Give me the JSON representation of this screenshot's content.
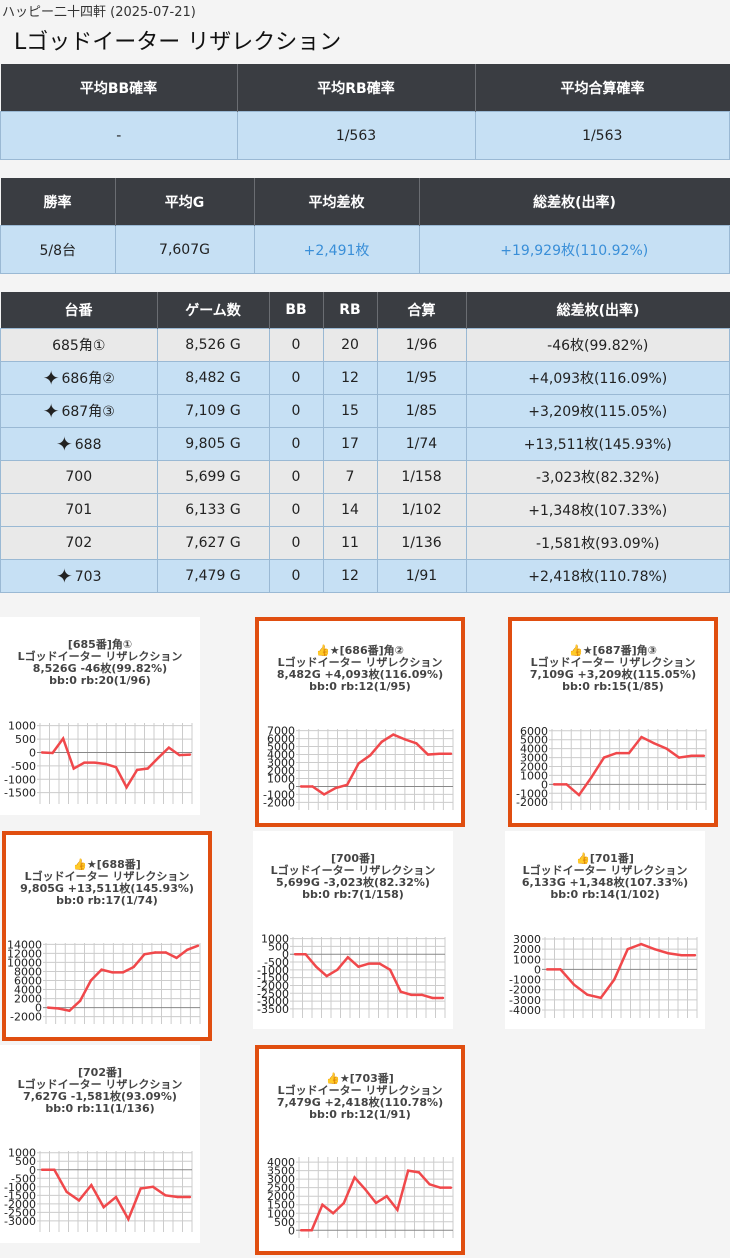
{
  "header": {
    "subtitle": "ハッピー二十四軒 (2025-07-21)",
    "title": "Lゴッドイーター リザレクション"
  },
  "summary1": {
    "headers": [
      "平均BB確率",
      "平均RB確率",
      "平均合算確率"
    ],
    "values": [
      "-",
      "1/563",
      "1/563"
    ]
  },
  "summary2": {
    "headers": [
      "勝率",
      "平均G",
      "平均差枚",
      "総差枚(出率)"
    ],
    "values": [
      "5/8台",
      "7,607G",
      "+2,491枚",
      "+19,929枚(110.92%)"
    ]
  },
  "machines": {
    "headers": [
      "台番",
      "ゲーム数",
      "BB",
      "RB",
      "合算",
      "総差枚(出率)"
    ],
    "rows": [
      {
        "no": "685角①",
        "games": "8,526 G",
        "bb": "0",
        "rb": "20",
        "total": "1/96",
        "diff": "-46枚(99.82%)",
        "star": false
      },
      {
        "no": "686角②",
        "games": "8,482 G",
        "bb": "0",
        "rb": "12",
        "total": "1/95",
        "diff": "+4,093枚(116.09%)",
        "star": true
      },
      {
        "no": "687角③",
        "games": "7,109 G",
        "bb": "0",
        "rb": "15",
        "total": "1/85",
        "diff": "+3,209枚(115.05%)",
        "star": true
      },
      {
        "no": "688",
        "games": "9,805 G",
        "bb": "0",
        "rb": "17",
        "total": "1/74",
        "diff": "+13,511枚(145.93%)",
        "star": true
      },
      {
        "no": "700",
        "games": "5,699 G",
        "bb": "0",
        "rb": "7",
        "total": "1/158",
        "diff": "-3,023枚(82.32%)",
        "star": false
      },
      {
        "no": "701",
        "games": "6,133 G",
        "bb": "0",
        "rb": "14",
        "total": "1/102",
        "diff": "+1,348枚(107.33%)",
        "star": false
      },
      {
        "no": "702",
        "games": "7,627 G",
        "bb": "0",
        "rb": "11",
        "total": "1/136",
        "diff": "-1,581枚(93.09%)",
        "star": false
      },
      {
        "no": "703",
        "games": "7,479 G",
        "bb": "0",
        "rb": "12",
        "total": "1/91",
        "diff": "+2,418枚(110.78%)",
        "star": true
      }
    ]
  },
  "chart_data": [
    {
      "type": "line",
      "title": [
        "[685番]角①",
        "Lゴッドイーター リザレクション",
        "8,526G -46枚(99.82%)",
        "bb:0 rb:20(1/96)"
      ],
      "yticks": [
        1000,
        500,
        0,
        -500,
        -1000,
        -1500
      ],
      "ylim": [
        -1700,
        1100
      ],
      "values": [
        0,
        -20,
        520,
        -600,
        -380,
        -380,
        -430,
        -550,
        -1300,
        -650,
        -600,
        -200,
        180,
        -100,
        -80
      ]
    },
    {
      "type": "line",
      "title": [
        "👍★[686番]角②",
        "Lゴッドイーター リザレクション",
        "8,482G +4,093枚(116.09%)",
        "bb:0 rb:12(1/95)"
      ],
      "yticks": [
        7000,
        6000,
        5000,
        4000,
        3000,
        2000,
        1000,
        0,
        -1000,
        -2000
      ],
      "ylim": [
        -2200,
        7200
      ],
      "values": [
        0,
        0,
        -1000,
        -200,
        200,
        2900,
        3900,
        5600,
        6500,
        5900,
        5400,
        4000,
        4100,
        4100
      ]
    },
    {
      "type": "line",
      "title": [
        "👍★[687番]角③",
        "Lゴッドイーター リザレクション",
        "7,109G +3,209枚(115.05%)",
        "bb:0 rb:15(1/85)"
      ],
      "yticks": [
        6000,
        5000,
        4000,
        3000,
        2000,
        1000,
        0,
        -1000,
        -2000
      ],
      "ylim": [
        -2200,
        6200
      ],
      "values": [
        0,
        0,
        -1200,
        800,
        3000,
        3500,
        3500,
        5300,
        4600,
        4000,
        3000,
        3200,
        3200
      ]
    },
    {
      "type": "line",
      "title": [
        "👍★[688番]",
        "Lゴッドイーター リザレクション",
        "9,805G +13,511枚(145.93%)",
        "bb:0 rb:17(1/74)"
      ],
      "yticks": [
        14000,
        12000,
        10000,
        8000,
        6000,
        4000,
        2000,
        0,
        -2000
      ],
      "ylim": [
        -2300,
        14300
      ],
      "values": [
        0,
        -200,
        -700,
        1500,
        6000,
        8400,
        7800,
        7800,
        9000,
        11800,
        12200,
        12200,
        11000,
        12800,
        13700
      ]
    },
    {
      "type": "line",
      "title": [
        "[700番]",
        "Lゴッドイーター リザレクション",
        "5,699G -3,023枚(82.32%)",
        "bb:0 rb:7(1/158)"
      ],
      "yticks": [
        1000,
        500,
        0,
        -500,
        -1000,
        -1500,
        -2000,
        -2500,
        -3000,
        -3500
      ],
      "ylim": [
        -3700,
        1100
      ],
      "values": [
        0,
        0,
        -800,
        -1400,
        -1000,
        -200,
        -800,
        -600,
        -600,
        -1000,
        -2400,
        -2600,
        -2600,
        -2800,
        -2800
      ]
    },
    {
      "type": "line",
      "title": [
        "👍[701番]",
        "Lゴッドイーター リザレクション",
        "6,133G +1,348枚(107.33%)",
        "bb:0 rb:14(1/102)"
      ],
      "yticks": [
        3000,
        2000,
        1000,
        0,
        -1000,
        -2000,
        -3000,
        -4000
      ],
      "ylim": [
        -4200,
        3200
      ],
      "values": [
        0,
        0,
        -1500,
        -2500,
        -2800,
        -1000,
        2000,
        2500,
        2000,
        1600,
        1400,
        1400
      ]
    },
    {
      "type": "line",
      "title": [
        "[702番]",
        "Lゴッドイーター リザレクション",
        "7,627G -1,581枚(93.09%)",
        "bb:0 rb:11(1/136)"
      ],
      "yticks": [
        1000,
        500,
        0,
        -500,
        -1000,
        -1500,
        -2000,
        -2500,
        -3000
      ],
      "ylim": [
        -3300,
        1100
      ],
      "values": [
        0,
        0,
        -1300,
        -1800,
        -900,
        -2200,
        -1600,
        -2900,
        -1100,
        -1000,
        -1500,
        -1600,
        -1600
      ]
    },
    {
      "type": "line",
      "title": [
        "👍★[703番]",
        "Lゴッドイーター リザレクション",
        "7,479G +2,418枚(110.78%)",
        "bb:0 rb:12(1/91)"
      ],
      "yticks": [
        4000,
        3500,
        3000,
        2500,
        2000,
        1500,
        1000,
        500,
        0
      ],
      "ylim": [
        -100,
        4300
      ],
      "values": [
        0,
        0,
        1500,
        1000,
        1600,
        3100,
        2400,
        1600,
        2000,
        1200,
        3500,
        3400,
        2700,
        2500,
        2500
      ]
    }
  ],
  "colors": {
    "line": "#f0484b",
    "highlight": "#e04e10"
  }
}
